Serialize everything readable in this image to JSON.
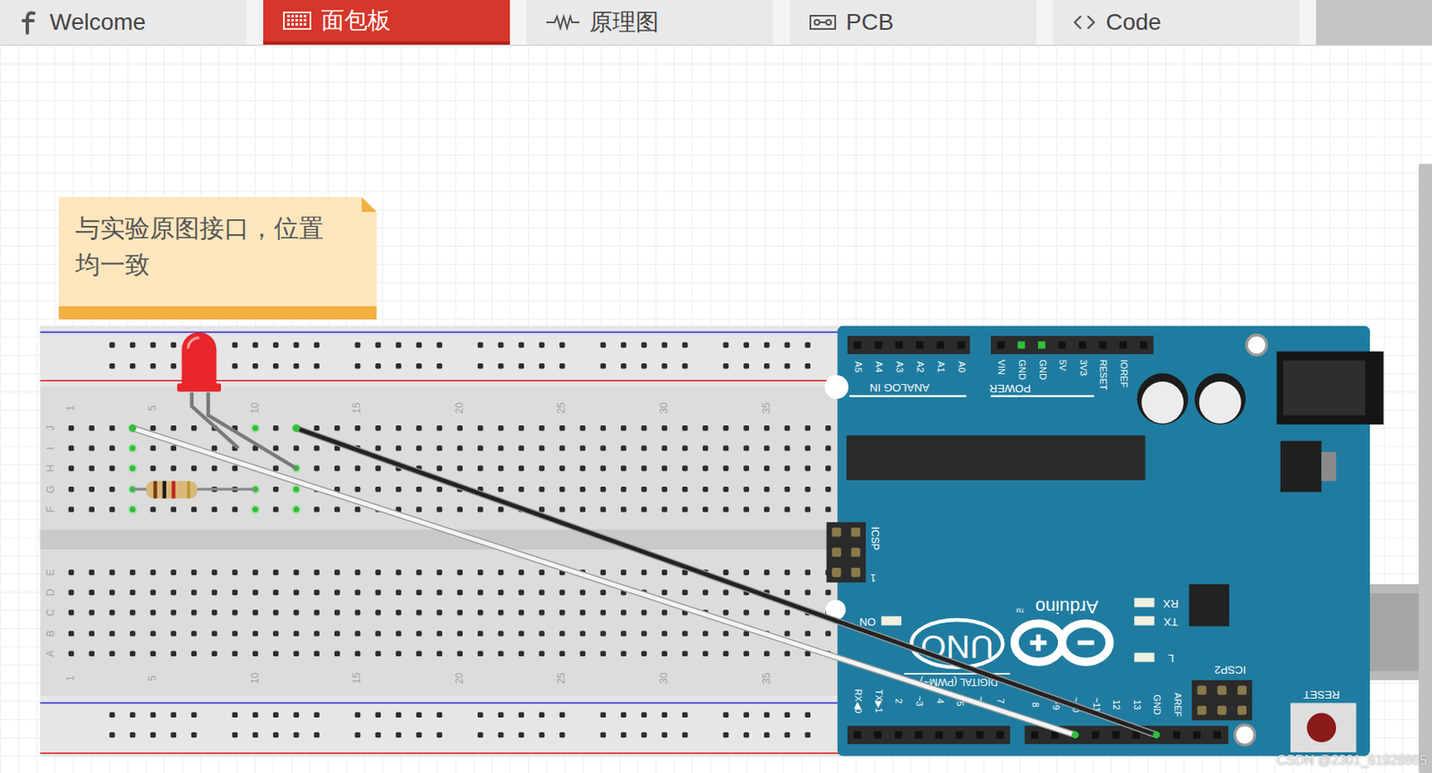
{
  "tabs": [
    {
      "label": "Welcome",
      "selected": false
    },
    {
      "label": "面包板",
      "selected": true
    },
    {
      "label": "原理图",
      "selected": false
    },
    {
      "label": "PCB",
      "selected": false
    },
    {
      "label": "Code",
      "selected": false
    }
  ],
  "note": {
    "text": "与实验原图接口，位置均一致"
  },
  "breadboard": {
    "column_numbers": [
      "1",
      "5",
      "10",
      "15",
      "20",
      "25",
      "30",
      "35"
    ],
    "rows_top": [
      "J",
      "I",
      "H",
      "G",
      "F"
    ],
    "rows_bottom": [
      "E",
      "D",
      "C",
      "B",
      "A"
    ],
    "connected_holes": [
      "4J",
      "4I",
      "4H",
      "4G",
      "4F",
      "10J",
      "10G",
      "10F",
      "12J",
      "12H",
      "12G",
      "12F"
    ]
  },
  "led": {
    "color": "#e8262b"
  },
  "wires": [
    {
      "to_pin": "~10",
      "color": "#f4f4f4"
    },
    {
      "to_pin": "GND",
      "color": "#222222"
    }
  ],
  "arduino": {
    "brand": "Arduino",
    "trademark": "TM",
    "model": "UNO",
    "analog_pins": [
      "A5",
      "A4",
      "A3",
      "A2",
      "A1",
      "A0"
    ],
    "analog_label": "ANALOG IN",
    "power_pins": [
      {
        "label": "VIN",
        "connected": false
      },
      {
        "label": "GND",
        "connected": true
      },
      {
        "label": "GND",
        "connected": true
      },
      {
        "label": "5V",
        "connected": false
      },
      {
        "label": "3V3",
        "connected": false
      },
      {
        "label": "RESET",
        "connected": false
      },
      {
        "label": "IOREF",
        "connected": false
      }
    ],
    "power_label": "POWER",
    "icsp": "ICSP",
    "icsp_pin": "1",
    "on_label": "ON",
    "leds": [
      "RX",
      "TX",
      "L"
    ],
    "icsp2": "ICSP2",
    "reset": "RESET",
    "digital_label": "DIGITAL (PWM~)",
    "digital_pins": [
      "RX◀0",
      "TX▶1",
      "2",
      "~3",
      "4",
      "~5",
      "~6",
      "7"
    ],
    "digital_pins_2": [
      "8",
      "~9",
      "~10",
      "~11",
      "12",
      "13",
      "GND",
      "AREF"
    ]
  },
  "watermark": "CSDN @2301_81928865"
}
